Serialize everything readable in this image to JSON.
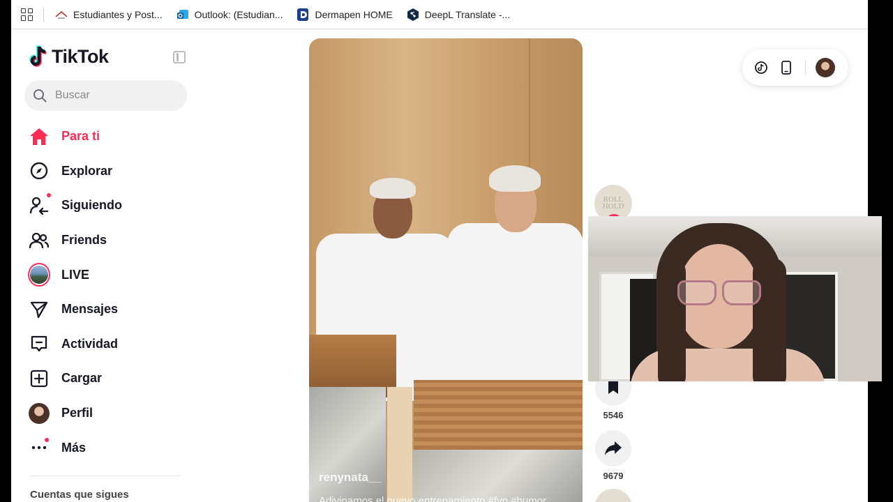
{
  "bookmarks": {
    "items": [
      {
        "label": "Estudiantes y Post...",
        "icon": "university-icon"
      },
      {
        "label": "Outlook: (Estudian...",
        "icon": "outlook-icon"
      },
      {
        "label": "Dermapen HOME",
        "icon": "dermapen-icon"
      },
      {
        "label": "DeepL Translate -...",
        "icon": "deepl-icon"
      }
    ]
  },
  "sidebar": {
    "logo_text": "TikTok",
    "search_placeholder": "Buscar",
    "nav": [
      {
        "label": "Para ti",
        "icon": "home-icon",
        "active": true
      },
      {
        "label": "Explorar",
        "icon": "compass-icon"
      },
      {
        "label": "Siguiendo",
        "icon": "following-icon",
        "badge": true
      },
      {
        "label": "Friends",
        "icon": "friends-icon"
      },
      {
        "label": "LIVE",
        "icon": "live-icon"
      },
      {
        "label": "Mensajes",
        "icon": "messages-icon"
      },
      {
        "label": "Actividad",
        "icon": "activity-icon"
      },
      {
        "label": "Cargar",
        "icon": "upload-icon"
      },
      {
        "label": "Perfil",
        "icon": "profile-avatar"
      },
      {
        "label": "Más",
        "icon": "more-icon",
        "badge": true
      }
    ],
    "following_title": "Cuentas que sigues"
  },
  "video": {
    "username": "renynata__",
    "caption": "Adivinamos el nuevo entrenamiento #fyp #humor"
  },
  "actions": {
    "creator_avatar_text": "ROLL HOLD",
    "save_count": "5546",
    "share_count": "9679"
  },
  "colors": {
    "accent": "#fe2c55",
    "text": "#161823"
  }
}
